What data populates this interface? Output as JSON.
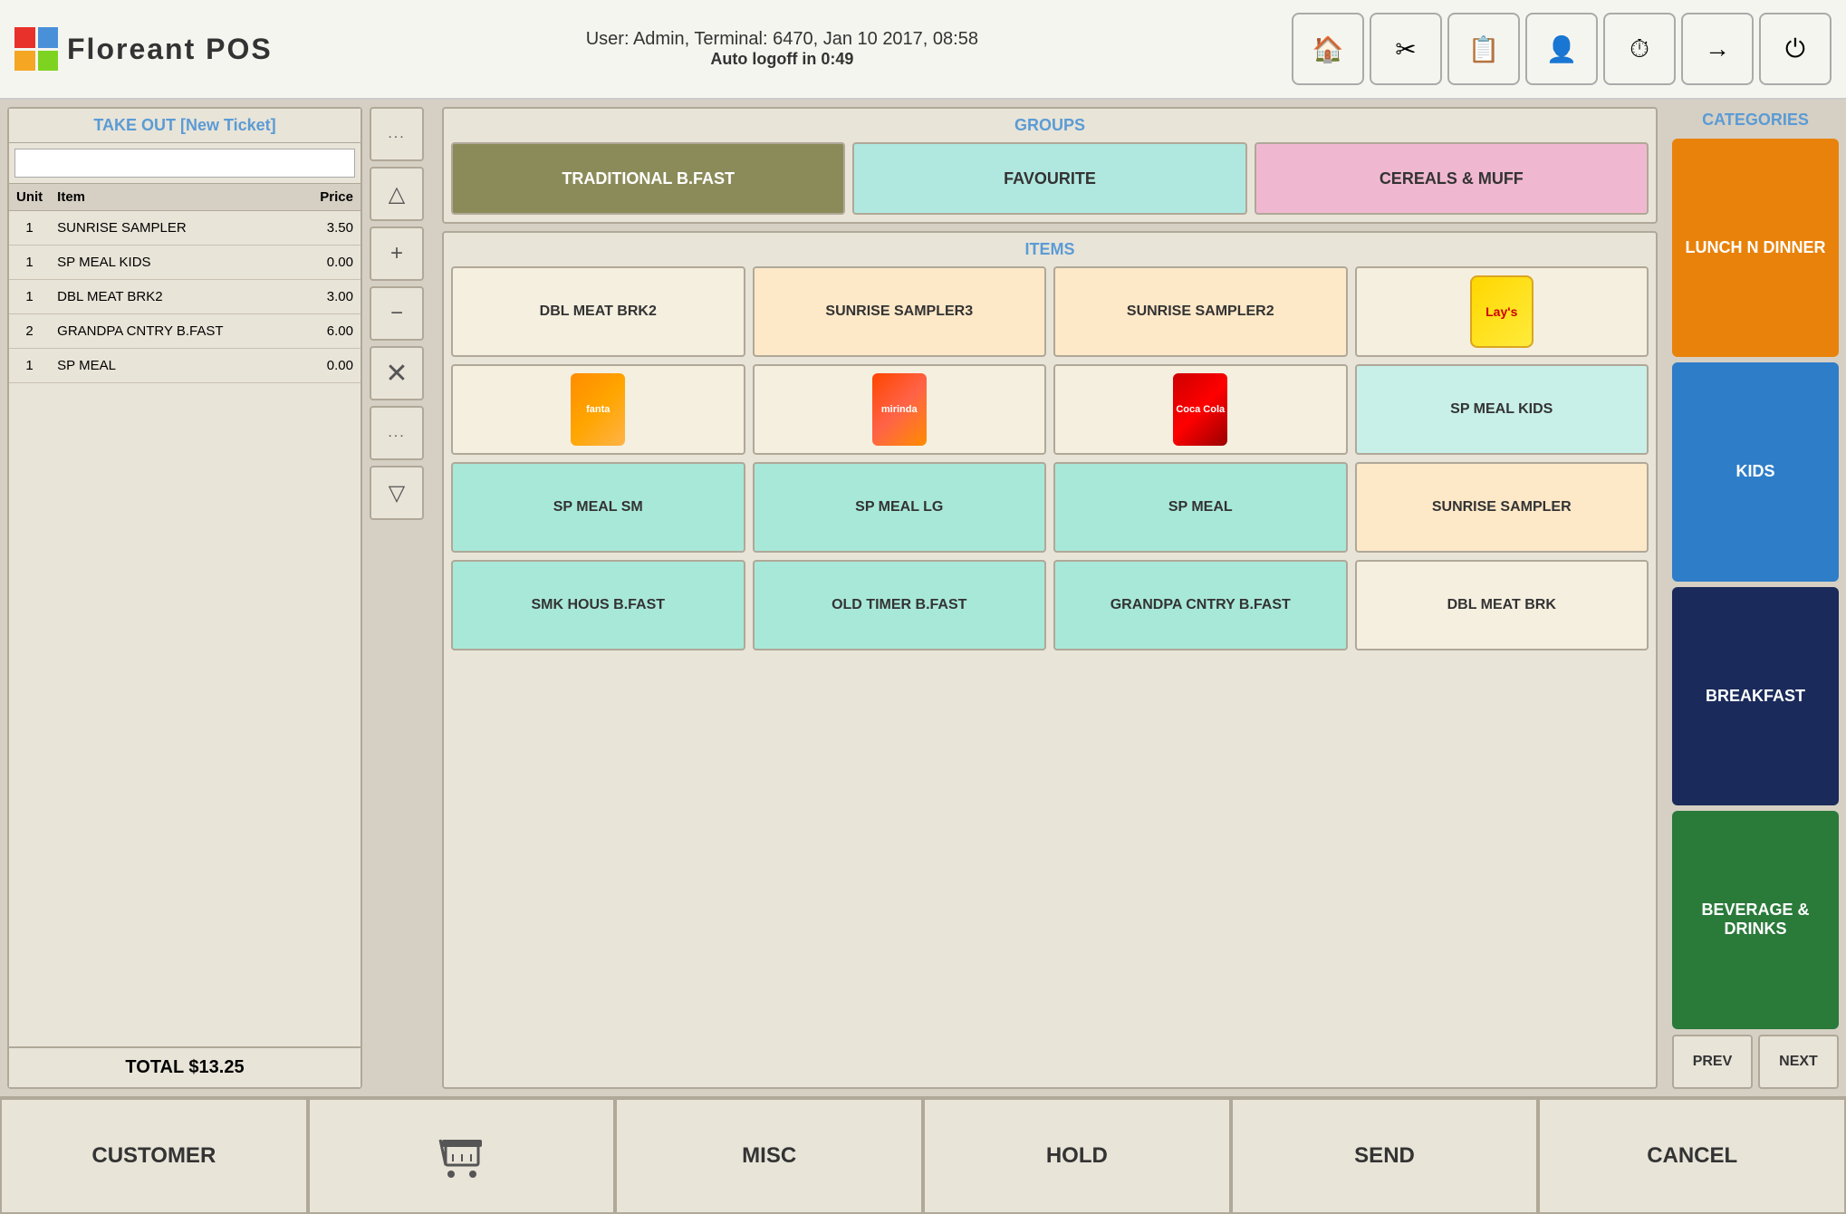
{
  "header": {
    "logo_text": "Floreant POS",
    "user_info": "User: Admin, Terminal: 6470, Jan 10 2017, 08:58",
    "auto_logoff": "Auto logoff in 0:49",
    "buttons": [
      {
        "name": "home",
        "icon": "🏠"
      },
      {
        "name": "tools",
        "icon": "🔧"
      },
      {
        "name": "reports",
        "icon": "📋"
      },
      {
        "name": "user-settings",
        "icon": "👤"
      },
      {
        "name": "timer",
        "icon": "⏱"
      },
      {
        "name": "exit",
        "icon": "➡"
      },
      {
        "name": "power",
        "icon": "⏻"
      }
    ]
  },
  "ticket": {
    "title": "TAKE OUT [New Ticket]",
    "search_placeholder": "",
    "columns": [
      "Unit",
      "Item",
      "Price"
    ],
    "rows": [
      {
        "unit": "1",
        "item": "SUNRISE SAMPLER",
        "price": "3.50"
      },
      {
        "unit": "1",
        "item": "SP MEAL KIDS",
        "price": "0.00"
      },
      {
        "unit": "1",
        "item": "DBL MEAT BRK2",
        "price": "3.00"
      },
      {
        "unit": "2",
        "item": "GRANDPA CNTRY B.FAST",
        "price": "6.00"
      },
      {
        "unit": "1",
        "item": "SP MEAL",
        "price": "0.00"
      }
    ],
    "total": "TOTAL $13.25"
  },
  "action_buttons": [
    {
      "name": "dots-top",
      "label": "..."
    },
    {
      "name": "triangle-up",
      "label": "△"
    },
    {
      "name": "plus",
      "label": "+"
    },
    {
      "name": "minus",
      "label": "−"
    },
    {
      "name": "close",
      "label": "×"
    },
    {
      "name": "dots-bottom",
      "label": "..."
    },
    {
      "name": "triangle-down",
      "label": "▽"
    }
  ],
  "groups": {
    "label": "GROUPS",
    "buttons": [
      {
        "name": "traditional",
        "label": "TRADITIONAL B.FAST",
        "style": "active"
      },
      {
        "name": "favourite",
        "label": "FAVOURITE",
        "style": "teal"
      },
      {
        "name": "cereals",
        "label": "CEREALS & MUFF",
        "style": "pink"
      }
    ]
  },
  "items": {
    "label": "ITEMS",
    "grid": [
      {
        "name": "dbl-meat-brk2",
        "label": "DBL MEAT BRK2",
        "style": "beige",
        "type": "text"
      },
      {
        "name": "sunrise-sampler3",
        "label": "SUNRISE SAMPLER3",
        "style": "peach",
        "type": "text"
      },
      {
        "name": "sunrise-sampler2",
        "label": "SUNRISE SAMPLER2",
        "style": "peach",
        "type": "text"
      },
      {
        "name": "lays",
        "label": "",
        "style": "beige",
        "type": "lays"
      },
      {
        "name": "fanta",
        "label": "",
        "style": "beige",
        "type": "fanta"
      },
      {
        "name": "mirinda",
        "label": "",
        "style": "beige",
        "type": "mirinda"
      },
      {
        "name": "coca-cola",
        "label": "",
        "style": "beige",
        "type": "cola"
      },
      {
        "name": "sp-meal-kids",
        "label": "SP MEAL KIDS",
        "style": "light-teal",
        "type": "text"
      },
      {
        "name": "sp-meal-sm",
        "label": "SP MEAL SM",
        "style": "teal",
        "type": "text"
      },
      {
        "name": "sp-meal-lg",
        "label": "SP MEAL LG",
        "style": "teal",
        "type": "text"
      },
      {
        "name": "sp-meal",
        "label": "SP MEAL",
        "style": "teal",
        "type": "text"
      },
      {
        "name": "sunrise-sampler",
        "label": "SUNRISE SAMPLER",
        "style": "peach",
        "type": "text"
      },
      {
        "name": "smk-hous-bfast",
        "label": "SMK HOUS B.FAST",
        "style": "teal",
        "type": "text"
      },
      {
        "name": "old-timer-bfast",
        "label": "OLD TIMER B.FAST",
        "style": "teal",
        "type": "text"
      },
      {
        "name": "grandpa-cntry-bfast",
        "label": "GRANDPA CNTRY B.FAST",
        "style": "teal",
        "type": "text"
      },
      {
        "name": "dbl-meat-brk",
        "label": "DBL MEAT BRK",
        "style": "beige",
        "type": "text"
      }
    ]
  },
  "categories": {
    "label": "CATEGORIES",
    "buttons": [
      {
        "name": "lunch-dinner",
        "label": "LUNCH N DINNER",
        "style": "orange"
      },
      {
        "name": "kids",
        "label": "KIDS",
        "style": "blue"
      },
      {
        "name": "breakfast",
        "label": "BREAKFAST",
        "style": "navy"
      },
      {
        "name": "beverage-drinks",
        "label": "BEVERAGE & DRINKS",
        "style": "green"
      }
    ],
    "nav": [
      {
        "name": "prev",
        "label": "PREV"
      },
      {
        "name": "next",
        "label": "NEXT"
      }
    ]
  },
  "bottom_bar": {
    "buttons": [
      {
        "name": "customer",
        "label": "CUSTOMER"
      },
      {
        "name": "cart",
        "label": "🛒"
      },
      {
        "name": "misc",
        "label": "MISC"
      },
      {
        "name": "hold",
        "label": "HOLD"
      },
      {
        "name": "send",
        "label": "SEND"
      },
      {
        "name": "cancel",
        "label": "CANCEL"
      }
    ]
  }
}
